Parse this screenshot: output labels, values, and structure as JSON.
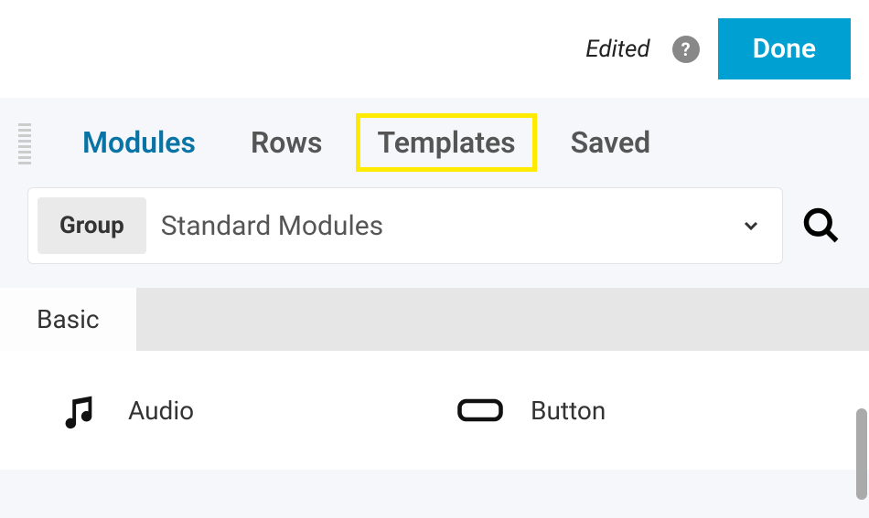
{
  "topbar": {
    "edited_label": "Edited",
    "done_label": "Done"
  },
  "tabs": {
    "modules": "Modules",
    "rows": "Rows",
    "templates": "Templates",
    "saved": "Saved"
  },
  "filter": {
    "group_label": "Group",
    "group_value": "Standard Modules"
  },
  "section": {
    "basic_label": "Basic"
  },
  "modules": {
    "audio": "Audio",
    "button": "Button"
  }
}
